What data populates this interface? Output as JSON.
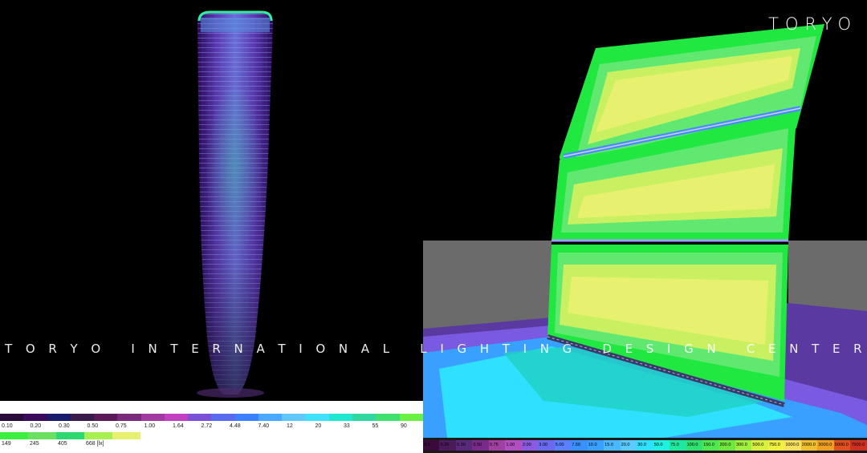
{
  "brand": {
    "logo_text": "TORYO"
  },
  "watermark": {
    "text": "TORYO INTERNATIONAL LIGHTING DESIGN CENTER"
  },
  "left_legend": {
    "row1_colors": [
      "#2a0a3a",
      "#3a0a5a",
      "#1a1a6a",
      "#3a1a4a",
      "#5a1a5a",
      "#7a2a7a",
      "#a03aa0",
      "#c040c0",
      "#7a50d8",
      "#5a6af0",
      "#3a80ff",
      "#4aa8ff",
      "#60c8ff",
      "#40e0ff",
      "#20e8d0",
      "#30d8a0",
      "#40e070",
      "#6af040"
    ],
    "row1_labels": [
      "0.10",
      "0.20",
      "0.30",
      "0.50",
      "0.75",
      "1.00",
      "1.64",
      "2.72",
      "4.48",
      "7.40",
      "12",
      "20",
      "33",
      "55",
      "90"
    ],
    "row2_colors": [
      "#3cf040",
      "#6ae060",
      "#2cd870",
      "#a8f050",
      "#e8f070"
    ],
    "row2_labels": [
      "149",
      "245",
      "405",
      "668 [lx]"
    ]
  },
  "right_legend": {
    "items": [
      {
        "label": "0.1",
        "color": "#3a0a3a"
      },
      {
        "label": "0.20",
        "color": "#4a1a5a"
      },
      {
        "label": "0.30",
        "color": "#5a2a7a"
      },
      {
        "label": "0.50",
        "color": "#7a2a8a"
      },
      {
        "label": "0.75",
        "color": "#a040a0"
      },
      {
        "label": "1.00",
        "color": "#b050c0"
      },
      {
        "label": "2.00",
        "color": "#8a5ae0"
      },
      {
        "label": "3.00",
        "color": "#6a6af0"
      },
      {
        "label": "5.00",
        "color": "#5a80ff"
      },
      {
        "label": "7.50",
        "color": "#3a90ff"
      },
      {
        "label": "10.0",
        "color": "#3aa0ff"
      },
      {
        "label": "15.0",
        "color": "#4ab8ff"
      },
      {
        "label": "20.0",
        "color": "#5acaff"
      },
      {
        "label": "30.0",
        "color": "#30e0ff"
      },
      {
        "label": "50.0",
        "color": "#20f0e0"
      },
      {
        "label": "75.0",
        "color": "#20e8a0"
      },
      {
        "label": "100.0",
        "color": "#30e070"
      },
      {
        "label": "150.0",
        "color": "#50e850"
      },
      {
        "label": "200.0",
        "color": "#70e840"
      },
      {
        "label": "300.0",
        "color": "#a0f040"
      },
      {
        "label": "500.0",
        "color": "#d8f040"
      },
      {
        "label": "750.0",
        "color": "#f0f040"
      },
      {
        "label": "1000.0",
        "color": "#f8e060"
      },
      {
        "label": "2000.0",
        "color": "#f0c030"
      },
      {
        "label": "3000.0",
        "color": "#f0a020"
      },
      {
        "label": "5000.0",
        "color": "#e05020"
      },
      {
        "label": "7500.0",
        "color": "#d03020"
      }
    ]
  }
}
